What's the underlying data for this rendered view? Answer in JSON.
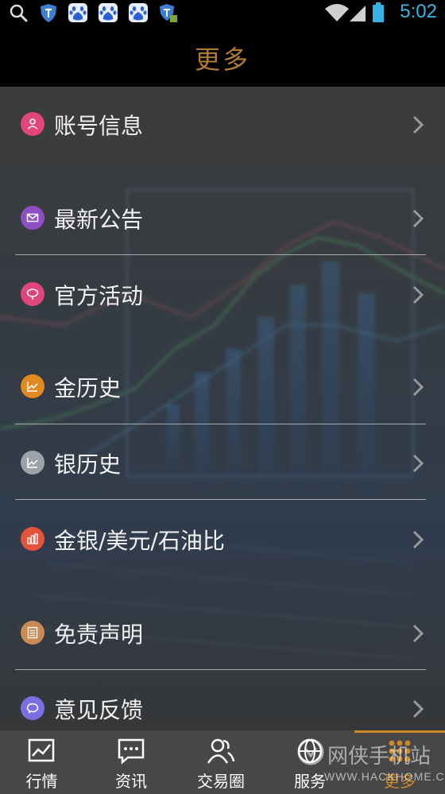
{
  "status_bar": {
    "time": "5:02",
    "time_color": "#33b5e5",
    "icons": [
      "search-icon",
      "shield-app-icon",
      "baidu-app-icon",
      "baidu-app-icon",
      "baidu-app-icon",
      "shield-app-icon",
      "wifi-icon",
      "signal-icon",
      "battery-icon"
    ]
  },
  "header": {
    "title": "更多",
    "title_color": "#b17a35"
  },
  "menu": {
    "items": [
      {
        "label": "账号信息",
        "icon": "account-icon",
        "color": "#e0457b"
      },
      {
        "label": "最新公告",
        "icon": "mail-icon",
        "color": "#8e4fc4"
      },
      {
        "label": "官方活动",
        "icon": "speech-bubble-icon",
        "color": "#e0457b"
      },
      {
        "label": "金历史",
        "icon": "gold-chart-icon",
        "color": "#e38a1f"
      },
      {
        "label": "银历史",
        "icon": "silver-chart-icon",
        "color": "#9aa3a8"
      },
      {
        "label": "金银/美元/石油比",
        "icon": "bar-chart-icon",
        "color": "#e5533d"
      },
      {
        "label": "免责声明",
        "icon": "document-icon",
        "color": "#c98a55"
      },
      {
        "label": "意见反馈",
        "icon": "feedback-icon",
        "color": "#7b6ee0"
      }
    ]
  },
  "bottom_nav": {
    "items": [
      {
        "label": "行情",
        "icon": "market-chart-icon"
      },
      {
        "label": "资讯",
        "icon": "news-icon"
      },
      {
        "label": "交易圈",
        "icon": "community-icon"
      },
      {
        "label": "服务",
        "icon": "service-icon"
      },
      {
        "label": "更多",
        "icon": "more-grid-icon",
        "active": true
      }
    ],
    "active_color": "#c98a2c"
  },
  "watermark": {
    "text": "网侠手机站",
    "sub": "WWW.HACKHOME.COM"
  }
}
